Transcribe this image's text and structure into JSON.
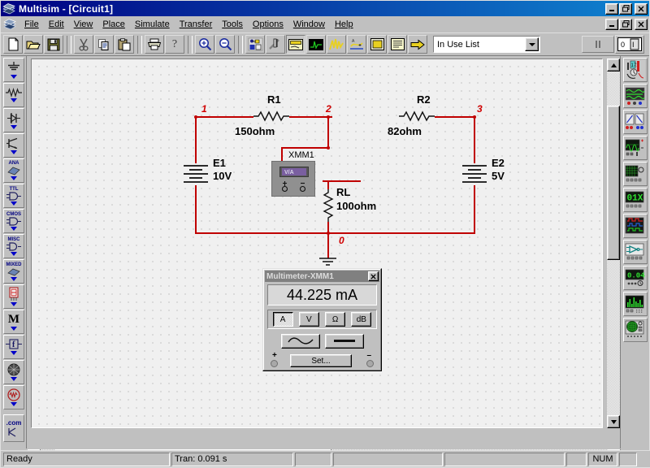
{
  "window": {
    "app_name": "Multisim",
    "document": "[Circuit1]",
    "title": "Multisim - [Circuit1]",
    "app_icon": "multisim-logo-icon",
    "buttons": {
      "minimize": "_",
      "restore": "❐",
      "close": "✕"
    },
    "mdi_buttons": {
      "minimize": "_",
      "restore": "❐",
      "close": "✕"
    }
  },
  "menu": {
    "items": [
      {
        "label": "File",
        "accel": "F"
      },
      {
        "label": "Edit",
        "accel": "E"
      },
      {
        "label": "View",
        "accel": "V"
      },
      {
        "label": "Place",
        "accel": "P"
      },
      {
        "label": "Simulate",
        "accel": "S"
      },
      {
        "label": "Transfer",
        "accel": "r"
      },
      {
        "label": "Tools",
        "accel": "T"
      },
      {
        "label": "Options",
        "accel": "O"
      },
      {
        "label": "Window",
        "accel": "W"
      },
      {
        "label": "Help",
        "accel": "H"
      }
    ]
  },
  "toolbar": {
    "buttons": [
      {
        "name": "new-icon",
        "tooltip": "New"
      },
      {
        "name": "open-icon",
        "tooltip": "Open"
      },
      {
        "name": "save-icon",
        "tooltip": "Save"
      },
      {
        "name": "cut-icon",
        "tooltip": "Cut"
      },
      {
        "name": "copy-icon",
        "tooltip": "Copy"
      },
      {
        "name": "paste-icon",
        "tooltip": "Paste"
      },
      {
        "name": "print-icon",
        "tooltip": "Print"
      },
      {
        "name": "help-icon",
        "tooltip": "Help"
      },
      {
        "name": "zoom-in-icon",
        "tooltip": "Zoom In"
      },
      {
        "name": "zoom-out-icon",
        "tooltip": "Zoom Out"
      },
      {
        "name": "database-icon",
        "tooltip": "Database"
      },
      {
        "name": "component-edit-icon",
        "tooltip": "Component Editor"
      },
      {
        "name": "instruments-icon",
        "tooltip": "Instruments"
      },
      {
        "name": "analysis-icon",
        "tooltip": "Analysis"
      },
      {
        "name": "postprocessor-icon",
        "tooltip": "Postprocessor"
      },
      {
        "name": "model-maker-icon",
        "tooltip": "Model Maker"
      },
      {
        "name": "subcircuit-icon",
        "tooltip": "Subcircuit"
      },
      {
        "name": "report-icon",
        "tooltip": "Report"
      },
      {
        "name": "transfer-icon",
        "tooltip": "Transfer"
      }
    ],
    "in_use_list": {
      "label": "In Use List",
      "value": "In Use List",
      "arrow_icon": "chevron-down-icon"
    },
    "pause_label": "‖",
    "pause_icon": "pause-icon",
    "power_icon": "power-switch-icon"
  },
  "component_palette": {
    "items": [
      {
        "name": "sources",
        "label": "",
        "icon": "ground-source-icon"
      },
      {
        "name": "basic",
        "label": "",
        "icon": "resistor-icon"
      },
      {
        "name": "diodes",
        "label": "",
        "icon": "diode-icon"
      },
      {
        "name": "transistors",
        "label": "",
        "icon": "transistor-icon"
      },
      {
        "name": "analog",
        "label": "ANA",
        "icon": "analog-icon"
      },
      {
        "name": "ttl",
        "label": "TTL",
        "icon": "ttl-gate-icon"
      },
      {
        "name": "cmos",
        "label": "CMOS",
        "icon": "cmos-gate-icon"
      },
      {
        "name": "misc-digital",
        "label": "MISC",
        "icon": "misc-gate-icon"
      },
      {
        "name": "mixed",
        "label": "MIXED",
        "icon": "mixed-icon"
      },
      {
        "name": "indicators",
        "label": "",
        "icon": "seven-segment-icon"
      },
      {
        "name": "miscellaneous",
        "label": "M",
        "icon": "misc-m-icon"
      },
      {
        "name": "rf",
        "label": "f",
        "icon": "rf-icon"
      },
      {
        "name": "electromechanical",
        "label": "",
        "icon": "electromech-icon"
      },
      {
        "name": "edison",
        "label": "",
        "icon": "edison-icon"
      },
      {
        "name": "web-components",
        "label": ".com",
        "icon": "dotcom-icon"
      }
    ]
  },
  "instruments_palette": {
    "items": [
      {
        "name": "multimeter",
        "icon": "multimeter-icon"
      },
      {
        "name": "function-generator",
        "icon": "function-generator-icon"
      },
      {
        "name": "wattmeter",
        "icon": "wattmeter-icon"
      },
      {
        "name": "oscilloscope",
        "icon": "oscilloscope-icon"
      },
      {
        "name": "bode-plotter",
        "icon": "bode-plotter-icon"
      },
      {
        "name": "word-generator",
        "icon": "word-generator-icon"
      },
      {
        "name": "logic-analyzer",
        "icon": "logic-analyzer-icon"
      },
      {
        "name": "logic-converter",
        "icon": "logic-converter-icon"
      },
      {
        "name": "distortion-analyzer",
        "icon": "distortion-analyzer-icon"
      },
      {
        "name": "spectrum-analyzer",
        "icon": "spectrum-analyzer-icon"
      },
      {
        "name": "network-analyzer",
        "icon": "network-analyzer-icon"
      }
    ]
  },
  "schematic": {
    "components": [
      {
        "ref": "R1",
        "value": "150ohm",
        "type": "resistor"
      },
      {
        "ref": "R2",
        "value": "82ohm",
        "type": "resistor"
      },
      {
        "ref": "RL",
        "value": "100ohm",
        "type": "resistor"
      },
      {
        "ref": "E1",
        "value": "10V",
        "type": "battery"
      },
      {
        "ref": "E2",
        "value": "5V",
        "type": "battery"
      },
      {
        "ref": "XMM1",
        "value": "",
        "type": "multimeter"
      }
    ],
    "net_labels": [
      "1",
      "2",
      "3",
      "0"
    ],
    "wire_color": "#c00000",
    "net_label_color": "#d00000"
  },
  "multimeter_dialog": {
    "title": "Multimeter-XMM1",
    "close_label": "✕",
    "reading": "44.225 mA",
    "modes": [
      {
        "label": "A",
        "name": "ammeter-mode",
        "selected": true
      },
      {
        "label": "V",
        "name": "voltmeter-mode",
        "selected": false
      },
      {
        "label": "Ω",
        "name": "ohmmeter-mode",
        "selected": false
      },
      {
        "label": "dB",
        "name": "decibel-mode",
        "selected": false
      }
    ],
    "waveforms": [
      {
        "name": "ac-mode",
        "icon": "sine-wave-icon",
        "selected": false
      },
      {
        "name": "dc-mode",
        "icon": "dc-line-icon",
        "selected": false
      }
    ],
    "set_button": "Set...",
    "terminal_plus": "+",
    "terminal_minus": "–"
  },
  "statusbar": {
    "message": "Ready",
    "simulation_time": "Tran: 0.091 s",
    "pane3": "",
    "pane4": "",
    "num_lock": "NUM"
  }
}
